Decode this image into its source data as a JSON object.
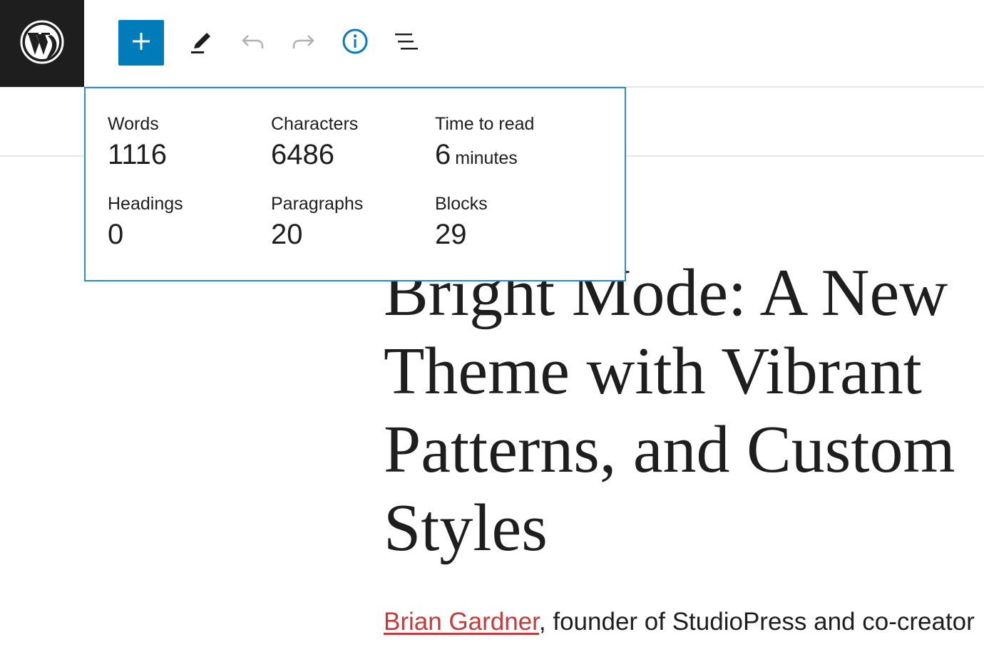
{
  "toolbar": {
    "logo_icon": "wordpress-logo-icon",
    "add_icon": "plus-icon",
    "edit_icon": "pencil-icon",
    "undo_icon": "undo-icon",
    "redo_icon": "redo-icon",
    "info_icon": "info-icon",
    "outline_icon": "list-view-icon",
    "accent_color": "#007cba"
  },
  "info_panel": {
    "words": {
      "label": "Words",
      "value": "1116"
    },
    "characters": {
      "label": "Characters",
      "value": "6486"
    },
    "time_to_read": {
      "label": "Time to read",
      "value": "6",
      "unit": "minutes"
    },
    "headings": {
      "label": "Headings",
      "value": "0"
    },
    "paragraphs": {
      "label": "Paragraphs",
      "value": "20"
    },
    "blocks": {
      "label": "Blocks",
      "value": "29"
    },
    "border_color": "#2f8bc5"
  },
  "post": {
    "title": "Bright Mode: A New Theme with Vibrant Patterns, and Custom Styles",
    "byline_author": "Brian Gardner",
    "byline_rest": ", founder of StudioPress and co-creator",
    "link_color": "#c53b3b"
  }
}
